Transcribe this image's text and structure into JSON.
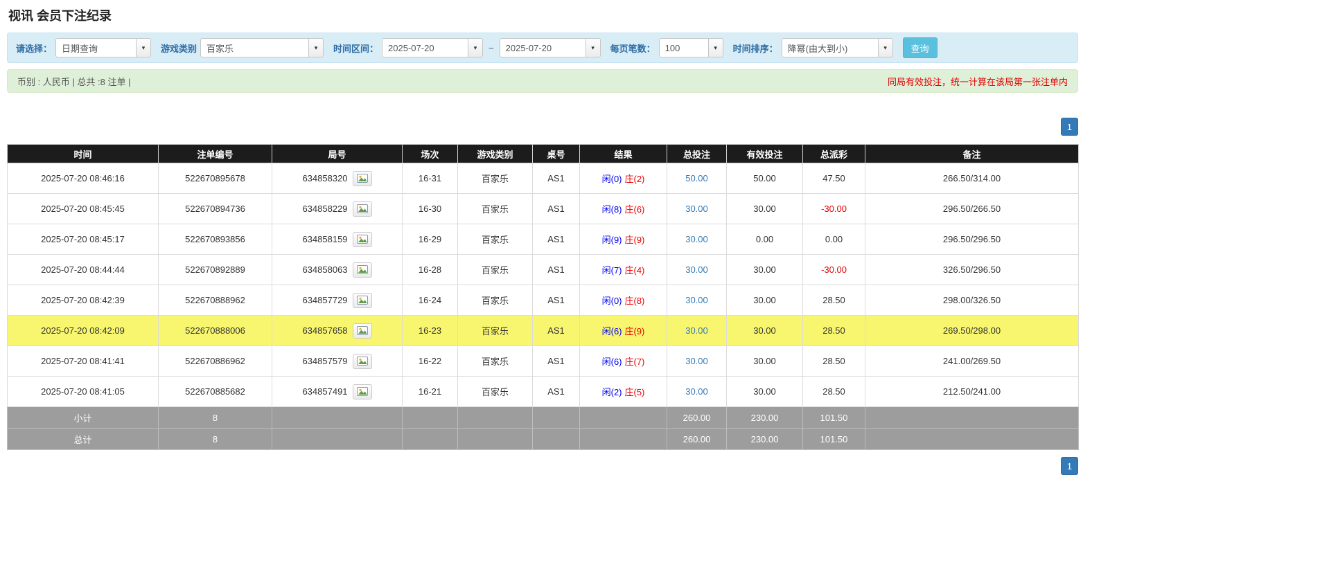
{
  "page": {
    "title": "视讯 会员下注纪录"
  },
  "icons": {
    "dropdown_arrow": "▾",
    "replay_icon": "replay-icon"
  },
  "colors": {
    "link_blue": "#337ab7",
    "player_blue": "#0000ee",
    "banker_red": "#ee0000",
    "negative_red": "#e60000",
    "highlight_yellow": "#f8f66e",
    "header_black": "#1c1c1c",
    "footer_gray": "#9d9d9d",
    "filter_bar_bg": "#d9edf7",
    "summary_bar_bg": "#dff0d8",
    "query_button_blue": "#5bc0de"
  },
  "filters": {
    "select_label": "请选择：",
    "select_value": "日期查询",
    "game_label": "游戏类别",
    "game_value": "百家乐",
    "range_label": "时间区间：",
    "date_from": "2025-07-20",
    "range_separator": "~",
    "date_to": "2025-07-20",
    "page_size_label": "每页笔数：",
    "page_size_value": "100",
    "sort_label": "时间排序：",
    "sort_value": "降幂(由大到小)",
    "query_button": "查询"
  },
  "summary": {
    "left": "币别 : 人民币 | 总共 :8 注单 |",
    "right": "同局有效投注，统一计算在该局第一张注单内"
  },
  "pagination": {
    "top": "1",
    "bottom": "1"
  },
  "table": {
    "headers": [
      "时间",
      "注单编号",
      "局号",
      "场次",
      "游戏类别",
      "桌号",
      "结果",
      "总投注",
      "有效投注",
      "总派彩",
      "备注"
    ],
    "rows": [
      {
        "time": "2025-07-20 08:46:16",
        "bet_id": "522670895678",
        "round_id": "634858320",
        "session": "16-31",
        "game": "百家乐",
        "table_no": "AS1",
        "player": "闲(0)",
        "banker": "庄(2)",
        "total_bet": "50.00",
        "valid_bet": "50.00",
        "payout": "47.50",
        "remark": "266.50/314.00",
        "highlight": false
      },
      {
        "time": "2025-07-20 08:45:45",
        "bet_id": "522670894736",
        "round_id": "634858229",
        "session": "16-30",
        "game": "百家乐",
        "table_no": "AS1",
        "player": "闲(8)",
        "banker": "庄(6)",
        "total_bet": "30.00",
        "valid_bet": "30.00",
        "payout": "-30.00",
        "remark": "296.50/266.50",
        "highlight": false
      },
      {
        "time": "2025-07-20 08:45:17",
        "bet_id": "522670893856",
        "round_id": "634858159",
        "session": "16-29",
        "game": "百家乐",
        "table_no": "AS1",
        "player": "闲(9)",
        "banker": "庄(9)",
        "total_bet": "30.00",
        "valid_bet": "0.00",
        "payout": "0.00",
        "remark": "296.50/296.50",
        "highlight": false
      },
      {
        "time": "2025-07-20 08:44:44",
        "bet_id": "522670892889",
        "round_id": "634858063",
        "session": "16-28",
        "game": "百家乐",
        "table_no": "AS1",
        "player": "闲(7)",
        "banker": "庄(4)",
        "total_bet": "30.00",
        "valid_bet": "30.00",
        "payout": "-30.00",
        "remark": "326.50/296.50",
        "highlight": false
      },
      {
        "time": "2025-07-20 08:42:39",
        "bet_id": "522670888962",
        "round_id": "634857729",
        "session": "16-24",
        "game": "百家乐",
        "table_no": "AS1",
        "player": "闲(0)",
        "banker": "庄(8)",
        "total_bet": "30.00",
        "valid_bet": "30.00",
        "payout": "28.50",
        "remark": "298.00/326.50",
        "highlight": false
      },
      {
        "time": "2025-07-20 08:42:09",
        "bet_id": "522670888006",
        "round_id": "634857658",
        "session": "16-23",
        "game": "百家乐",
        "table_no": "AS1",
        "player": "闲(6)",
        "banker": "庄(9)",
        "total_bet": "30.00",
        "valid_bet": "30.00",
        "payout": "28.50",
        "remark": "269.50/298.00",
        "highlight": true
      },
      {
        "time": "2025-07-20 08:41:41",
        "bet_id": "522670886962",
        "round_id": "634857579",
        "session": "16-22",
        "game": "百家乐",
        "table_no": "AS1",
        "player": "闲(6)",
        "banker": "庄(7)",
        "total_bet": "30.00",
        "valid_bet": "30.00",
        "payout": "28.50",
        "remark": "241.00/269.50",
        "highlight": false
      },
      {
        "time": "2025-07-20 08:41:05",
        "bet_id": "522670885682",
        "round_id": "634857491",
        "session": "16-21",
        "game": "百家乐",
        "table_no": "AS1",
        "player": "闲(2)",
        "banker": "庄(5)",
        "total_bet": "30.00",
        "valid_bet": "30.00",
        "payout": "28.50",
        "remark": "212.50/241.00",
        "highlight": false
      }
    ],
    "subtotal": {
      "label": "小计",
      "count": "8",
      "total_bet": "260.00",
      "valid_bet": "230.00",
      "payout": "101.50"
    },
    "total": {
      "label": "总计",
      "count": "8",
      "total_bet": "260.00",
      "valid_bet": "230.00",
      "payout": "101.50"
    }
  }
}
